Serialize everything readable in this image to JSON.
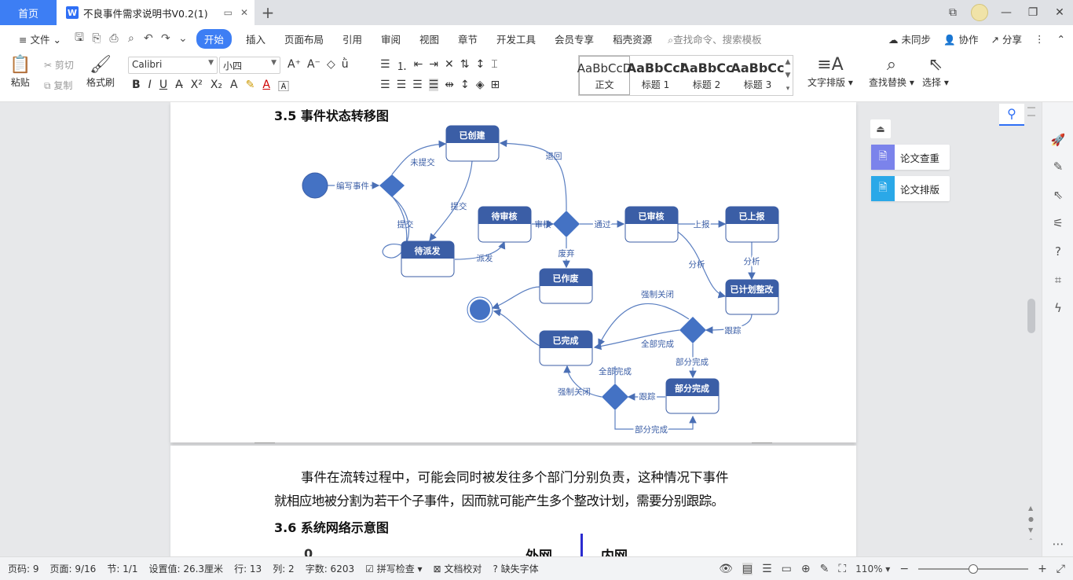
{
  "tabs": {
    "home": "首页",
    "document": "不良事件需求说明书V0.2(1)",
    "logo": "W"
  },
  "menu": {
    "file": "文件",
    "items": [
      "开始",
      "插入",
      "页面布局",
      "引用",
      "审阅",
      "视图",
      "章节",
      "开发工具",
      "会员专享",
      "稻壳资源"
    ],
    "search_placeholder": "查找命令、搜索模板",
    "unsynced": "未同步",
    "collab": "协作",
    "share": "分享"
  },
  "ribbon": {
    "paste": "粘贴",
    "cut": "剪切",
    "copy": "复制",
    "format_painter": "格式刷",
    "font": "Calibri",
    "size": "小四",
    "styles": [
      {
        "sample": "AaBbCcD",
        "label": "正文"
      },
      {
        "sample": "AaBbCcl",
        "label": "标题 1"
      },
      {
        "sample": "AaBbCc",
        "label": "标题 2"
      },
      {
        "sample": "AaBbCc",
        "label": "标题 3"
      }
    ],
    "text_layout": "文字排版",
    "find_replace": "查找替换",
    "select": "选择"
  },
  "document": {
    "heading_35": "3.5 事件状态转移图",
    "para_line1": "事件在流转过程中，可能会同时被发往多个部门分别负责，这种情况下事件",
    "para_line2": "就相应地被分割为若干个子事件，因而就可能产生多个整改计划，需要分别跟踪。",
    "heading_36": "3.6 系统网络示意图",
    "network_outer": "外网",
    "network_inner": "内网"
  },
  "diagram": {
    "states": {
      "created": "已创建",
      "pending_review": "待审核",
      "pending_dispatch": "待派发",
      "reviewed": "已审核",
      "reported": "已上报",
      "voided": "已作废",
      "planned": "已计划整改",
      "completed": "已完成",
      "partial": "部分完成"
    },
    "edges": {
      "write_event": "编写事件",
      "not_submitted": "未提交",
      "submit": "提交",
      "submit2": "提交",
      "return": "退回",
      "review": "审核",
      "pass": "通过",
      "report": "上报",
      "analyze": "分析",
      "analyze2": "分析",
      "dispatch": "派发",
      "void": "废弃",
      "force_close": "强制关闭",
      "force_close2": "强制关闭",
      "all_done": "全部完成",
      "all_done2": "全部完成",
      "track": "跟踪",
      "track2": "跟踪",
      "partial_done": "部分完成",
      "partial_done2": "部分完成"
    }
  },
  "side_panel": {
    "paper_check": "论文查重",
    "paper_layout": "论文排版"
  },
  "status": {
    "page_no": "页码: 9",
    "page": "页面: 9/16",
    "section": "节: 1/1",
    "setting": "设置值: 26.3厘米",
    "row": "行: 13",
    "col": "列: 2",
    "words": "字数: 6203",
    "spell": "拼写检查",
    "proof": "文档校对",
    "missing_font": "缺失字体",
    "zoom": "110%"
  },
  "colors": {
    "accent": "#3d7ef4",
    "state_fill": "#3b5ea6",
    "diamond": "#4472c4"
  }
}
